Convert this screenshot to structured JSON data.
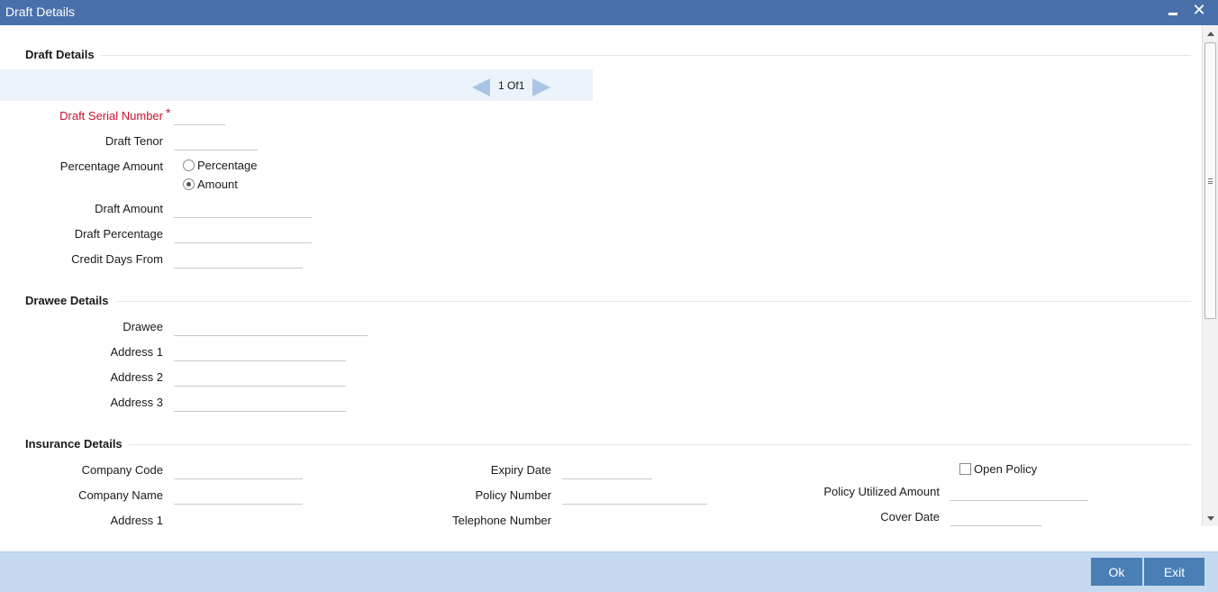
{
  "window": {
    "title": "Draft Details"
  },
  "sections": {
    "draft": "Draft Details",
    "drawee": "Drawee Details",
    "insurance": "Insurance Details"
  },
  "pager": {
    "current": "1",
    "of_label": "Of",
    "total": "1"
  },
  "draft": {
    "serial_number_label": "Draft Serial Number",
    "required_marker": "*",
    "tenor_label": "Draft Tenor",
    "percentage_amount_label": "Percentage Amount",
    "radio_percentage": "Percentage",
    "radio_amount": "Amount",
    "amount_label": "Draft Amount",
    "percentage_label": "Draft Percentage",
    "credit_days_label": "Credit Days From"
  },
  "drawee": {
    "drawee_label": "Drawee",
    "address1_label": "Address 1",
    "address2_label": "Address 2",
    "address3_label": "Address 3"
  },
  "insurance": {
    "company_code_label": "Company Code",
    "company_name_label": "Company Name",
    "address1_label": "Address 1",
    "expiry_date_label": "Expiry Date",
    "policy_number_label": "Policy Number",
    "telephone_label": "Telephone Number",
    "open_policy_label": "Open Policy",
    "policy_utilized_label": "Policy Utilized Amount",
    "cover_date_label": "Cover Date"
  },
  "footer": {
    "ok": "Ok",
    "exit": "Exit"
  }
}
